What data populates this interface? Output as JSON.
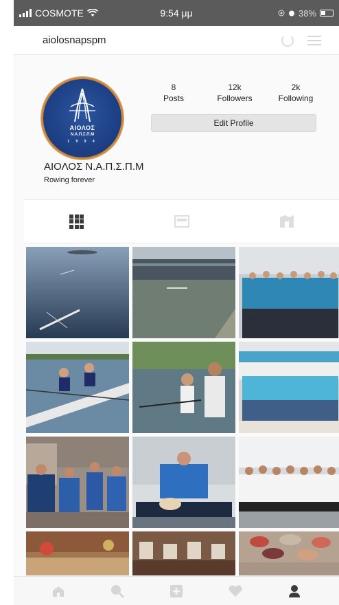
{
  "status_bar": {
    "carrier": "COSMOTE",
    "time": "9:54 μμ",
    "battery": "38%"
  },
  "header": {
    "username": "aiolosnapspm"
  },
  "profile": {
    "logo_line1": "ΑΙΟΛΟΣ",
    "logo_line2": "Ν.Α.Π.Σ.Π.Μ",
    "logo_line3": "1 9 9 4",
    "stats": [
      {
        "value": "8",
        "label": "Posts"
      },
      {
        "value": "12k",
        "label": "Followers"
      },
      {
        "value": "2k",
        "label": "Following"
      }
    ],
    "edit_button": "Edit Profile",
    "display_name": "ΑΙΟΛΟΣ Ν.Α.Π.Σ.Π.Μ",
    "bio": "Rowing forever"
  },
  "tabs": [
    {
      "icon": "grid-icon",
      "active": true
    },
    {
      "icon": "list-icon",
      "active": false
    },
    {
      "icon": "tagged-icon",
      "active": false
    }
  ],
  "bottom_nav": [
    {
      "icon": "home-icon"
    },
    {
      "icon": "search-icon"
    },
    {
      "icon": "add-post-icon"
    },
    {
      "icon": "heart-icon"
    },
    {
      "icon": "profile-icon"
    }
  ],
  "colors": {
    "status_bar": "#5b5b5b",
    "avatar_blue": "#1c3d80",
    "avatar_ring": "#c9883a",
    "active_icon": "#3b3b3b",
    "inactive_icon": "#d6d6d6"
  }
}
